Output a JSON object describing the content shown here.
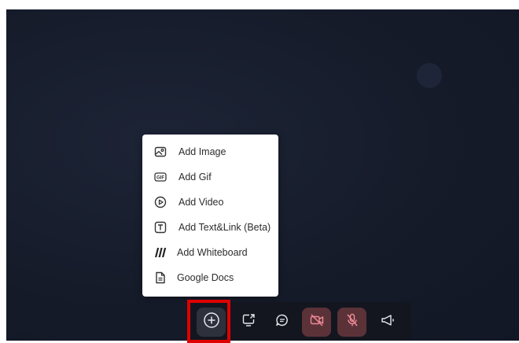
{
  "menu": {
    "items": [
      {
        "label": "Add Image",
        "icon": "image-icon"
      },
      {
        "label": "Add Gif",
        "icon": "gif-icon"
      },
      {
        "label": "Add Video",
        "icon": "play-circle-icon"
      },
      {
        "label": "Add Text&Link (Beta)",
        "icon": "text-box-icon"
      },
      {
        "label": "Add Whiteboard",
        "icon": "miro-icon"
      },
      {
        "label": "Google Docs",
        "icon": "document-icon"
      }
    ]
  },
  "toolbar": {
    "buttons": [
      {
        "name": "add",
        "icon": "plus-circle-icon"
      },
      {
        "name": "screen-share",
        "icon": "screen-share-icon"
      },
      {
        "name": "chat",
        "icon": "chat-icon"
      },
      {
        "name": "camera-off",
        "icon": "camera-off-icon"
      },
      {
        "name": "mic-off",
        "icon": "mic-off-icon"
      },
      {
        "name": "announce",
        "icon": "megaphone-icon"
      }
    ]
  },
  "colors": {
    "background": "#151b29",
    "menu_bg": "#ffffff",
    "toolbar_bg": "#13161f",
    "muted_button": "#5b3238",
    "highlight": "#e00000"
  }
}
